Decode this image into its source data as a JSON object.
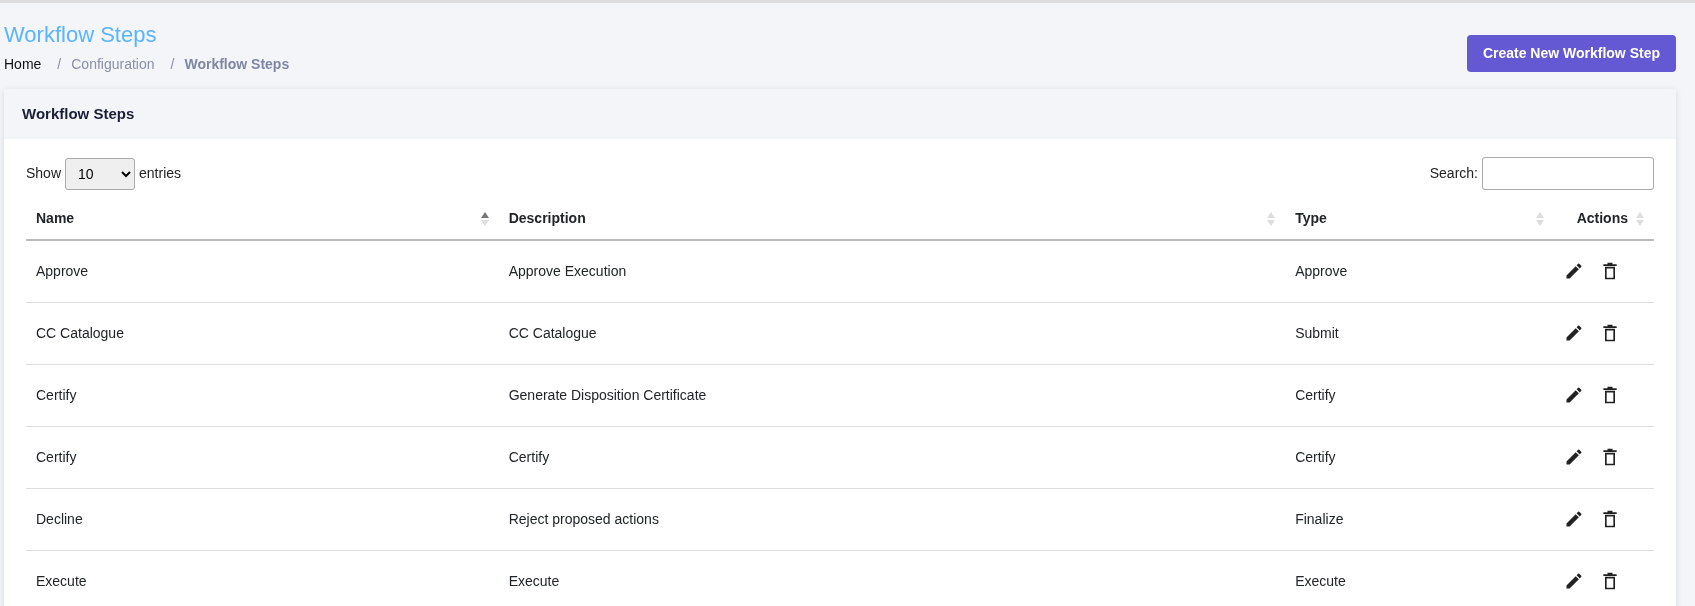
{
  "page": {
    "title": "Workflow Steps",
    "create_button": "Create New Workflow Step"
  },
  "breadcrumb": [
    {
      "label": "Home",
      "current": false,
      "link": true
    },
    {
      "separator": "/",
      "label": "Configuration",
      "current": false,
      "link": false
    },
    {
      "separator": "/",
      "label": "Workflow Steps",
      "current": true,
      "link": false
    }
  ],
  "card": {
    "title": "Workflow Steps",
    "length_label_before": "Show",
    "length_value": "10",
    "length_label_after": "entries",
    "search_label": "Search:"
  },
  "table": {
    "columns": [
      {
        "label": "Name",
        "sorted_ascending": true
      },
      {
        "label": "Description",
        "sorted_ascending": false
      },
      {
        "label": "Type",
        "sorted_ascending": false
      },
      {
        "label": "Actions",
        "sorted_ascending": false
      }
    ],
    "rows": [
      {
        "name": "Approve",
        "description": "Approve Execution",
        "type": "Approve"
      },
      {
        "name": "CC Catalogue",
        "description": "CC Catalogue",
        "type": "Submit"
      },
      {
        "name": "Certify",
        "description": "Generate Disposition Certificate",
        "type": "Certify"
      },
      {
        "name": "Certify",
        "description": "Certify",
        "type": "Certify"
      },
      {
        "name": "Decline",
        "description": "Reject proposed actions",
        "type": "Finalize"
      },
      {
        "name": "Execute",
        "description": "Execute",
        "type": "Execute"
      }
    ]
  }
}
